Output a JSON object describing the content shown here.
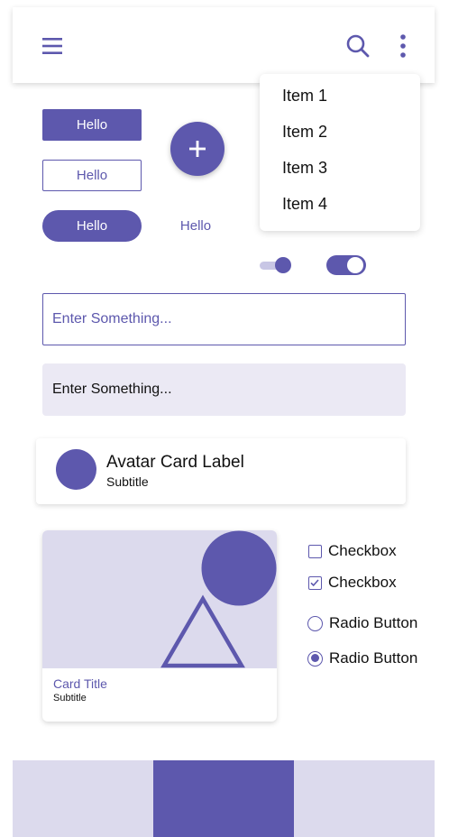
{
  "colors": {
    "primary": "#5d58ad",
    "primary_light": "#dcdaed",
    "input_fill": "#ebe9f4",
    "text": "#111111",
    "surface": "#ffffff"
  },
  "appbar": {
    "menu_icon": "hamburger-icon",
    "search_icon": "search-icon",
    "more_icon": "more-vertical-icon"
  },
  "menu": {
    "items": [
      "Item 1",
      "Item 2",
      "Item 3",
      "Item 4"
    ]
  },
  "buttons": {
    "filled_label": "Hello",
    "outlined_label": "Hello",
    "pill_label": "Hello",
    "text_label": "Hello",
    "fab_icon": "plus-icon"
  },
  "switches": {
    "switch_a_on": true,
    "switch_b_on": true
  },
  "inputs": {
    "outlined_placeholder": "Enter Something...",
    "filled_placeholder": "Enter Something..."
  },
  "avatar_card": {
    "title": "Avatar Card Label",
    "subtitle": "Subtitle"
  },
  "media_card": {
    "title": "Card Title",
    "subtitle": "Subtitle"
  },
  "checkboxes": [
    {
      "label": "Checkbox",
      "checked": false
    },
    {
      "label": "Checkbox",
      "checked": true
    }
  ],
  "radios": [
    {
      "label": "Radio Button",
      "selected": false
    },
    {
      "label": "Radio Button",
      "selected": true
    }
  ],
  "bottom_nav": {
    "segments": 3,
    "active_index": 1
  }
}
